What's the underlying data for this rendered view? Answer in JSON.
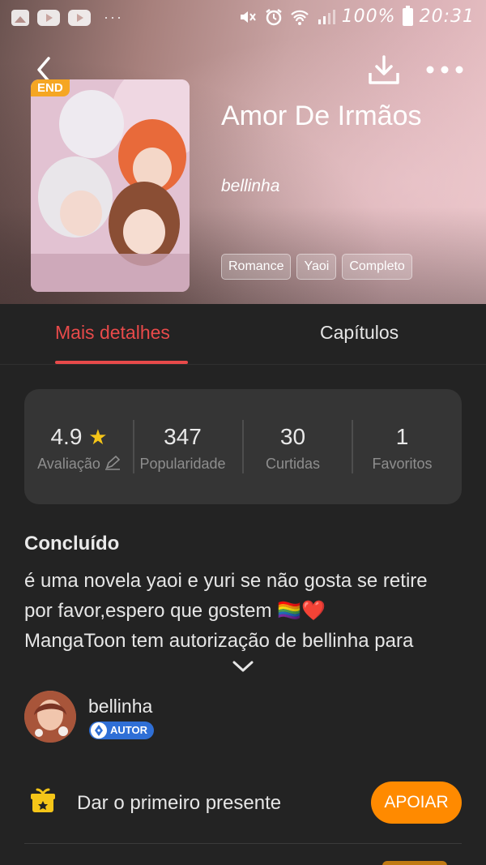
{
  "status_bar": {
    "battery": "100%",
    "time": "20:31",
    "icons": [
      "gallery-icon",
      "youtube-icon",
      "youtube-icon",
      "more-dots-icon",
      "mute-icon",
      "alarm-icon",
      "wifi-icon",
      "signal-icon",
      "battery-icon"
    ]
  },
  "header": {
    "back_icon": "chevron-left-icon",
    "download_icon": "download-icon",
    "more_icon": "more-horizontal-icon",
    "badge": "END",
    "title": "Amor De Irmãos",
    "author": "bellinha",
    "tags": [
      "Romance",
      "Yaoi",
      "Completo"
    ]
  },
  "tabs": [
    {
      "label": "Mais detalhes",
      "active": true
    },
    {
      "label": "Capítulos",
      "active": false
    }
  ],
  "stats": [
    {
      "value": "4.9",
      "label": "Avaliação",
      "icon": "star-icon",
      "extra_icon": "edit-icon"
    },
    {
      "value": "347",
      "label": "Popularidade"
    },
    {
      "value": "30",
      "label": "Curtidas"
    },
    {
      "value": "1",
      "label": "Favoritos"
    }
  ],
  "status_heading": "Concluído",
  "description": {
    "line1": "é uma novela yaoi e yuri se não gosta se retire",
    "line2": "por favor,espero que gostem 🏳️‍🌈❤️",
    "line3": "MangaToon tem autorização de bellinha para"
  },
  "author_card": {
    "name": "bellinha",
    "badge": "AUTOR"
  },
  "gift": {
    "text": "Dar o primeiro presente",
    "button": "APOIAR"
  },
  "colors": {
    "accent_red": "#e84a4a",
    "support_orange": "#ff8a00",
    "badge_yellow": "#f5a623",
    "author_badge_blue": "#2f6fd6",
    "background": "#232323",
    "card": "#353535"
  }
}
